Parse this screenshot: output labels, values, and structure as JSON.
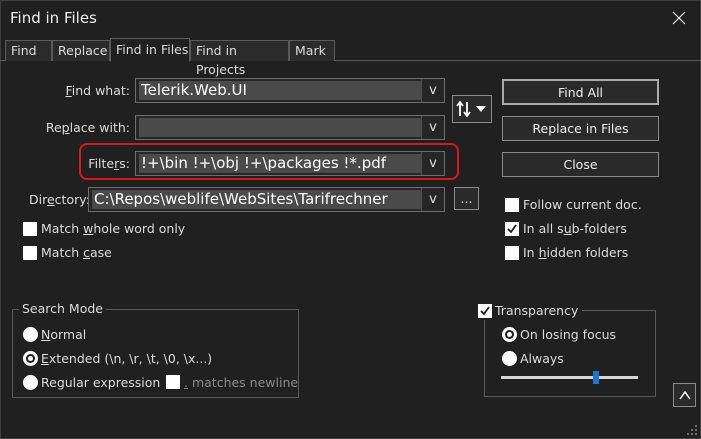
{
  "window": {
    "title": "Find in Files"
  },
  "tabs": [
    {
      "label": "Find"
    },
    {
      "label": "Replace"
    },
    {
      "label": "Find in Files"
    },
    {
      "label": "Find in Projects"
    },
    {
      "label": "Mark"
    }
  ],
  "fields": {
    "find_what": {
      "label_pre": "",
      "label_key": "F",
      "label_post": "ind what:",
      "value": "Telerik.Web.UI"
    },
    "replace_with": {
      "label_pre": "Re",
      "label_key": "p",
      "label_post": "lace with:",
      "value": ""
    },
    "filters": {
      "label_pre": "Filte",
      "label_key": "r",
      "label_post": "s:",
      "value": "!+\\bin !+\\obj !+\\packages !*.pdf"
    },
    "directory": {
      "label_pre": "Dir",
      "label_key": "e",
      "label_post": "ctory:",
      "value": "C:\\Repos\\weblife\\WebSites\\Tarifrechner"
    }
  },
  "buttons": {
    "find_all": "Find All",
    "replace_in_files": "Replace in Files",
    "close": "Close",
    "browse": "...",
    "expand": "^"
  },
  "options": {
    "match_whole_word": {
      "pre": "Match ",
      "key": "w",
      "post": "hole word only",
      "checked": false
    },
    "match_case": {
      "pre": "Match ",
      "key": "c",
      "post": "ase",
      "checked": false
    },
    "follow_current_doc": {
      "label": "Follow current doc.",
      "checked": false
    },
    "in_all_sub_folders": {
      "pre": "In all s",
      "key": "u",
      "post": "b-folders",
      "checked": true
    },
    "in_hidden_folders": {
      "pre": "In ",
      "key": "h",
      "post": "idden folders",
      "checked": false
    }
  },
  "search_mode": {
    "title": "Search Mode",
    "normal": {
      "key": "N",
      "post": "ormal",
      "selected": false
    },
    "extended": {
      "key": "E",
      "post": "xtended (\\n, \\r, \\t, \\0, \\x...)",
      "selected": true
    },
    "regex": {
      "label": "Regular expression",
      "selected": false
    },
    "matches_newline": {
      "key": ".",
      "post": " matches newline",
      "checked": false
    }
  },
  "transparency": {
    "label": "Transparency",
    "checked": true,
    "on_losing_focus": {
      "label": "On losing focus",
      "selected": true
    },
    "always": {
      "label": "Always",
      "selected": false
    },
    "level": 0.7
  },
  "colors": {
    "highlight": "#e0141e",
    "slider_thumb": "#1a78d2"
  }
}
